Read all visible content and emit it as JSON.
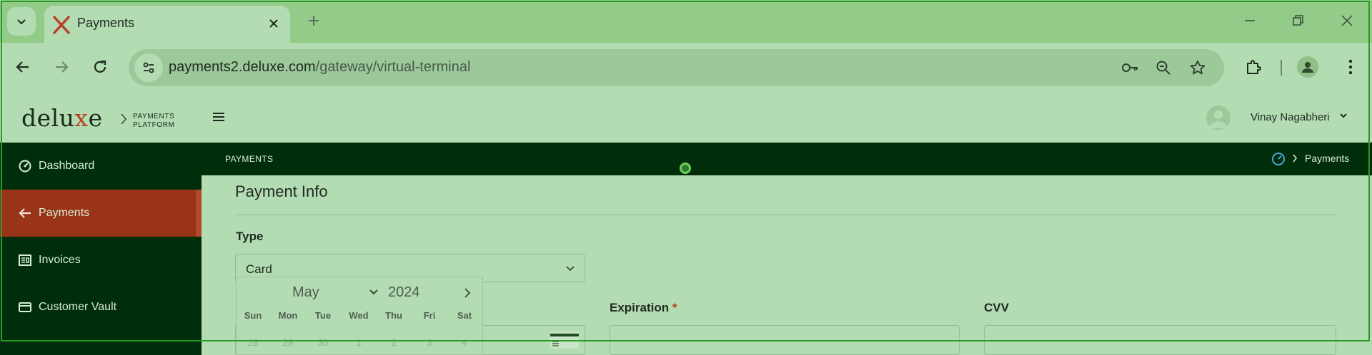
{
  "browser": {
    "tab_title": "Payments",
    "url_host": "payments2.deluxe.com",
    "url_path": "/gateway/virtual-terminal"
  },
  "app": {
    "logo_pre": "delu",
    "logo_x": "x",
    "logo_post": "e",
    "platform_line1": "PAYMENTS",
    "platform_line2": "PLATFORM",
    "user_name": "Vinay Nagabheri"
  },
  "sidebar": {
    "items": [
      {
        "label": "Dashboard",
        "icon": "dashboard-icon"
      },
      {
        "label": "Payments",
        "icon": "payments-arrow-icon",
        "active": true
      },
      {
        "label": "Invoices",
        "icon": "invoice-icon"
      },
      {
        "label": "Customer Vault",
        "icon": "card-icon"
      }
    ]
  },
  "breadcrumb": {
    "section": "PAYMENTS",
    "current": "Payments"
  },
  "form": {
    "section_title": "Payment Info",
    "type_label": "Type",
    "type_value": "Card",
    "expiration_label": "Expiration",
    "required_mark": "*",
    "cvv_label": "CVV"
  },
  "datepicker": {
    "month": "May",
    "year": "2024",
    "weekdays": [
      "Sun",
      "Mon",
      "Tue",
      "Wed",
      "Thu",
      "Fri",
      "Sat"
    ],
    "first_row": [
      "28",
      "29",
      "30",
      "1",
      "2",
      "3",
      "4"
    ]
  },
  "colors": {
    "accent_active": "#993419",
    "sidebar_bg": "#002e0b",
    "page_bg": "#b3dcb3"
  }
}
